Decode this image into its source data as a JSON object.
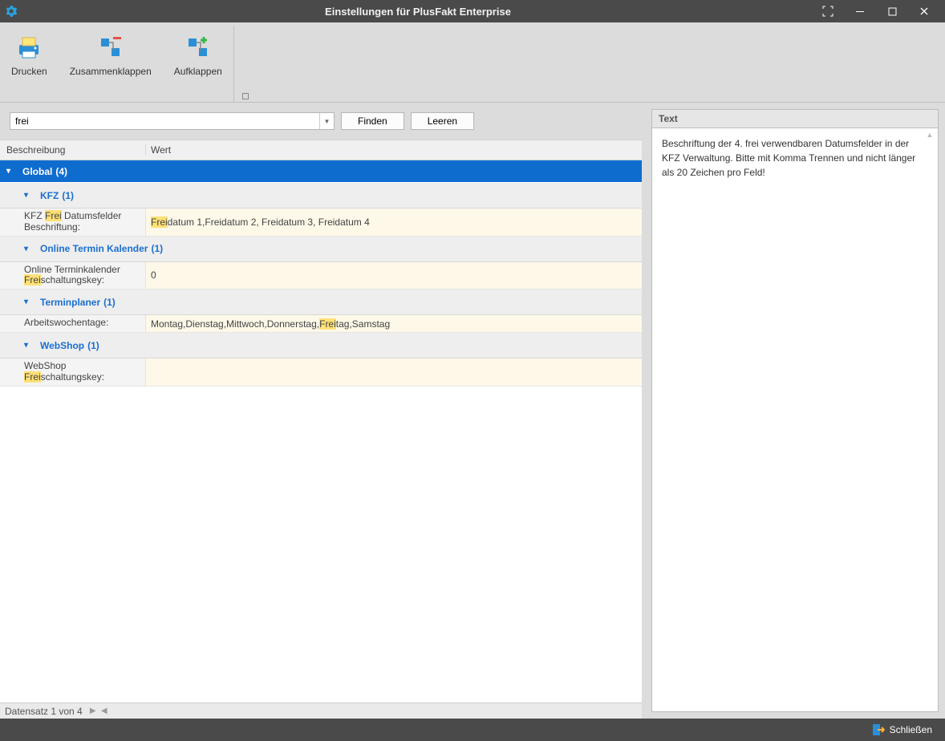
{
  "window": {
    "title": "Einstellungen für PlusFakt Enterprise"
  },
  "ribbon": {
    "print": "Drucken",
    "collapse": "Zusammenklappen",
    "expand": "Aufklappen"
  },
  "search": {
    "value": "frei",
    "find": "Finden",
    "clear": "Leeren"
  },
  "columns": {
    "desc": "Beschreibung",
    "val": "Wert"
  },
  "groups": {
    "global": {
      "label": "Global",
      "count": "(4)"
    },
    "kfz": {
      "label": "KFZ",
      "count": "(1)",
      "row_desc_pre": "KFZ ",
      "row_desc_hi": "Frei",
      "row_desc_post": " Datumsfelder Beschriftung:",
      "row_val_hi": "Frei",
      "row_val_post": "datum 1,Freidatum 2, Freidatum 3, Freidatum 4"
    },
    "otk": {
      "label": "Online Termin Kalender",
      "count": "(1)",
      "row_desc_pre": "Online Terminkalender ",
      "row_desc_hi": "Frei",
      "row_desc_post": "schaltungskey:",
      "row_val": "0"
    },
    "tp": {
      "label": "Terminplaner",
      "count": "(1)",
      "row_desc": "Arbeitswochentage:",
      "row_val_pre": "Montag,Dienstag,Mittwoch,Donnerstag,",
      "row_val_hi": "Frei",
      "row_val_post": "tag,Samstag"
    },
    "ws": {
      "label": "WebShop",
      "count": "(1)",
      "row_desc_pre": "WebShop ",
      "row_desc_hi": "Frei",
      "row_desc_post": "schaltungskey:",
      "row_val": ""
    }
  },
  "pager": {
    "text": "Datensatz 1 von 4"
  },
  "right": {
    "header": "Text",
    "body": "Beschriftung der 4. frei verwendbaren Datumsfelder in der KFZ Verwaltung. Bitte mit Komma Trennen und nicht länger als 20 Zeichen pro Feld!"
  },
  "footer": {
    "close": "Schließen"
  }
}
